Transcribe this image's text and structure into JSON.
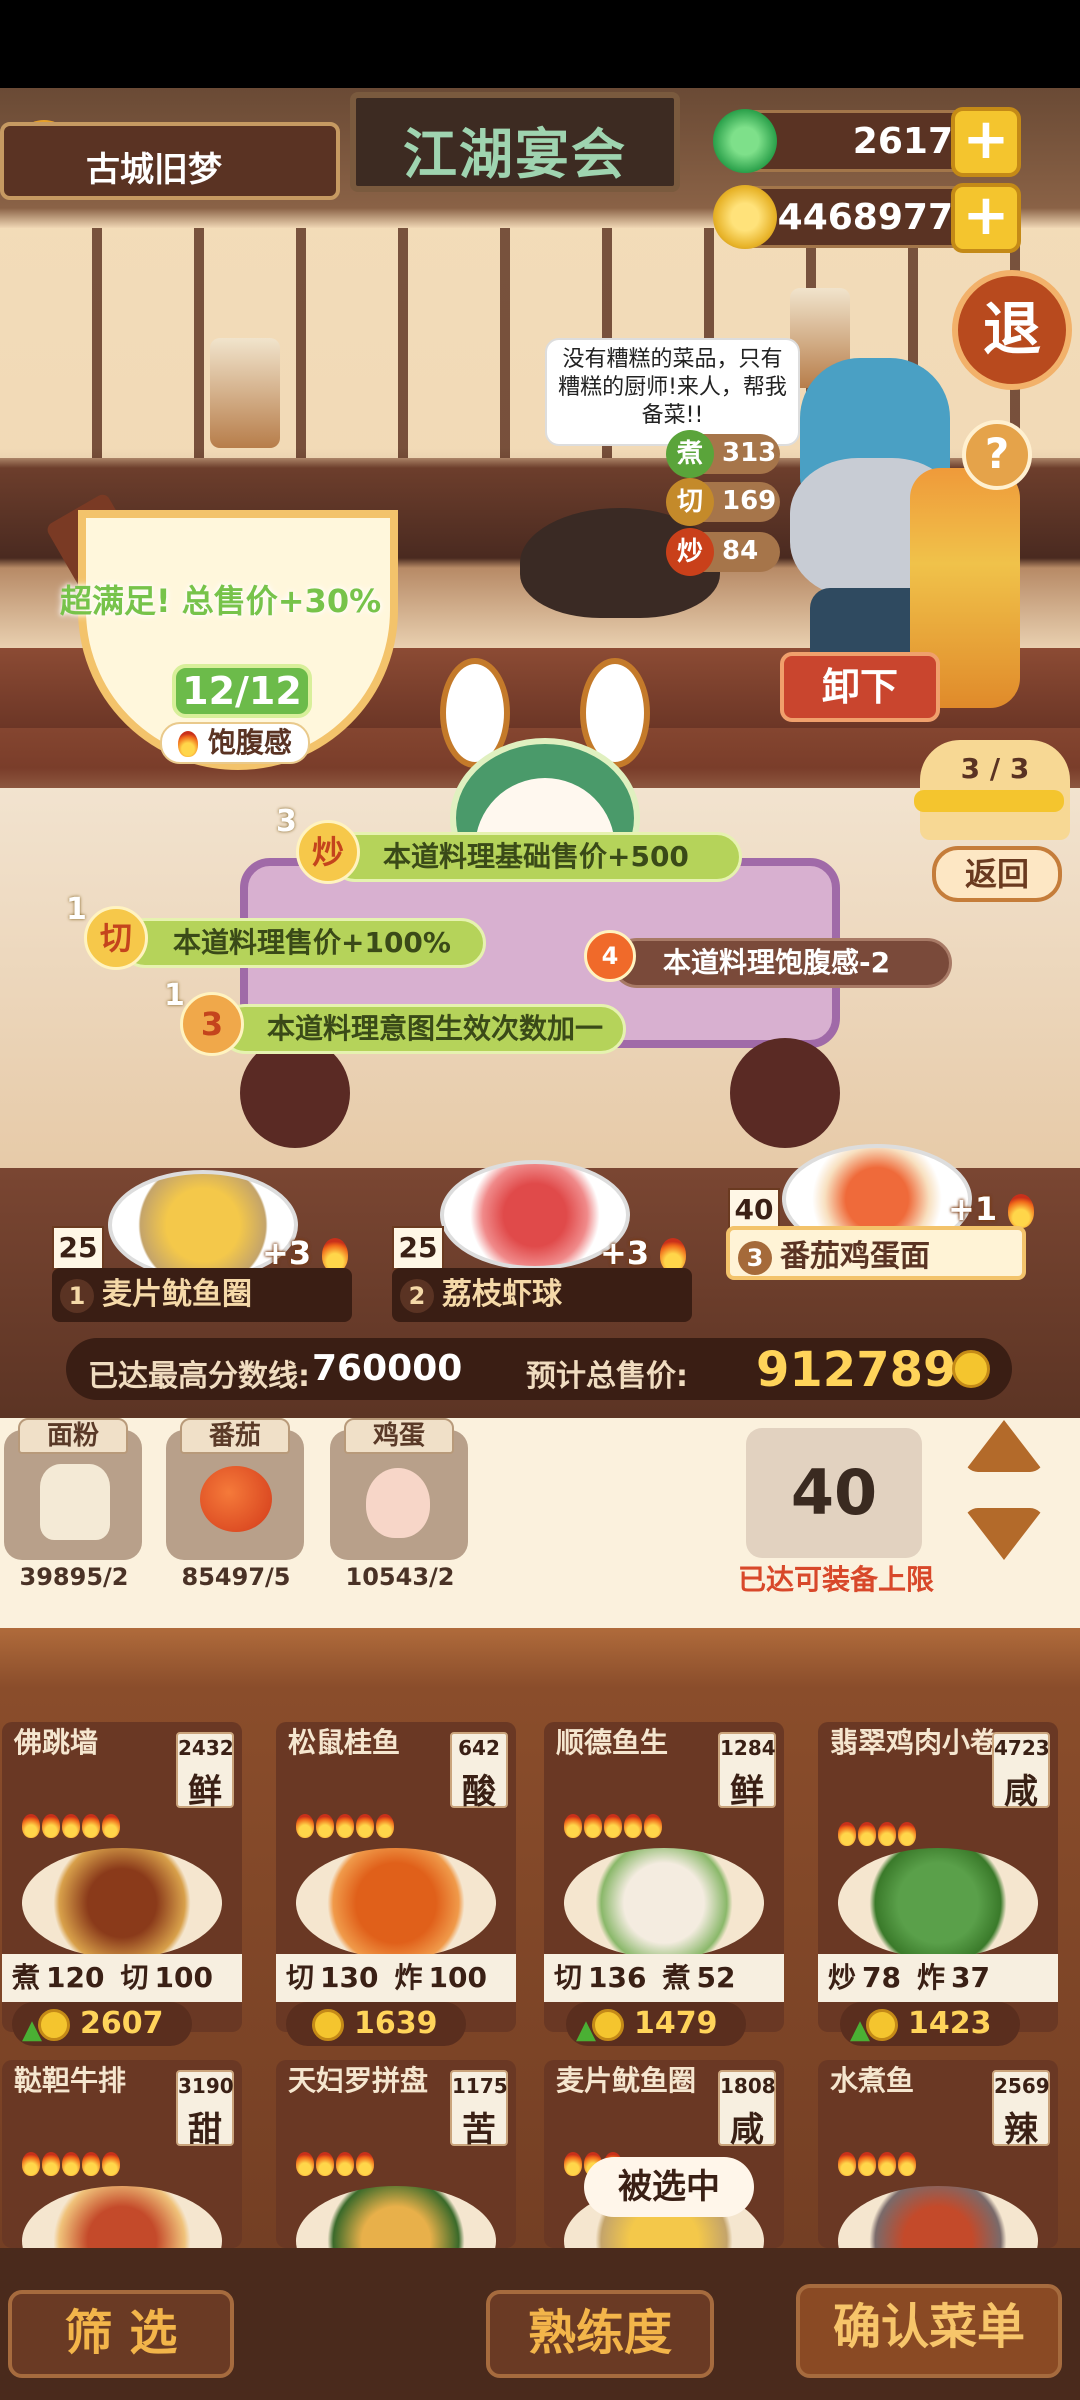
{
  "header": {
    "location": "古城旧梦",
    "sign_title": "江湖宴会",
    "jade_amount": "2617",
    "coin_amount": "4468977",
    "retreat_label": "退",
    "help_label": "?"
  },
  "chef": {
    "speech": "没有糟糕的菜品，只有糟糕的厨师!来人，帮我备菜!!",
    "skills": [
      {
        "icon": "煮",
        "value": "313"
      },
      {
        "icon": "切",
        "value": "169"
      },
      {
        "icon": "炒",
        "value": "84"
      }
    ]
  },
  "bowl": {
    "bonus_text": "超满足!  总售价+30%",
    "fraction": "12/12",
    "label": "饱腹感"
  },
  "controls": {
    "unload_label": "卸下",
    "page_indicator": "3 / 3",
    "return_label": "返回"
  },
  "buffs": [
    {
      "count": "3",
      "icon": "炒",
      "text": "本道料理基础售价+500"
    },
    {
      "count": "1",
      "icon": "切",
      "text": "本道料理售价+100%"
    },
    {
      "count": "1",
      "icon": "3",
      "text": "本道料理意图生效次数加一"
    },
    {
      "count": "",
      "icon": "4",
      "text": "本道料理饱腹感-2"
    }
  ],
  "table_dishes": [
    {
      "level": "25",
      "index": "1",
      "name": "麦片鱿鱼圈",
      "bonus": "+3"
    },
    {
      "level": "25",
      "index": "2",
      "name": "荔枝虾球",
      "bonus": "+3"
    },
    {
      "level": "40",
      "index": "3",
      "name": "番茄鸡蛋面",
      "bonus": "+1"
    }
  ],
  "score": {
    "best_label": "已达最高分数线:",
    "best_value": "760000",
    "total_label": "预计总售价:",
    "total_value": "912789"
  },
  "ingredients": [
    {
      "name": "面粉",
      "count": "39895/2"
    },
    {
      "name": "番茄",
      "count": "85497/5"
    },
    {
      "name": "鸡蛋",
      "count": "10543/2"
    }
  ],
  "equip": {
    "value": "40",
    "note": "已达可装备上限"
  },
  "recipes": [
    {
      "name": "佛跳墙",
      "price": "2432",
      "taste": "鲜",
      "flames": 5,
      "s1": "煮",
      "v1": "120",
      "s2": "切",
      "v2": "100",
      "sell": "2607",
      "up": true
    },
    {
      "name": "松鼠桂鱼",
      "price": "642",
      "taste": "酸",
      "flames": 5,
      "s1": "切",
      "v1": "130",
      "s2": "炸",
      "v2": "100",
      "sell": "1639",
      "up": false
    },
    {
      "name": "顺德鱼生",
      "price": "1284",
      "taste": "鲜",
      "flames": 5,
      "s1": "切",
      "v1": "136",
      "s2": "煮",
      "v2": "52",
      "sell": "1479",
      "up": true
    },
    {
      "name": "翡翠鸡肉小卷",
      "price": "4723",
      "taste": "咸",
      "flames": 4,
      "s1": "炒",
      "v1": "78",
      "s2": "炸",
      "v2": "37",
      "sell": "1423",
      "up": true
    },
    {
      "name": "鞑靼牛排",
      "price": "3190",
      "taste": "甜",
      "flames": 5
    },
    {
      "name": "天妇罗拼盘",
      "price": "1175",
      "taste": "苦",
      "flames": 4
    },
    {
      "name": "麦片鱿鱼圈",
      "price": "1808",
      "taste": "咸",
      "flames": 3
    },
    {
      "name": "水煮鱼",
      "price": "2569",
      "taste": "辣",
      "flames": 4
    }
  ],
  "selected_label": "被选中",
  "bottom": {
    "filter_label": "筛 选",
    "proficiency_label": "熟练度",
    "confirm_label": "确认菜单"
  },
  "colors": {
    "wood_dark": "#5a3323",
    "gold": "#ffd45a",
    "green_buff": "#b5d35a",
    "warning_red": "#d8482a"
  }
}
